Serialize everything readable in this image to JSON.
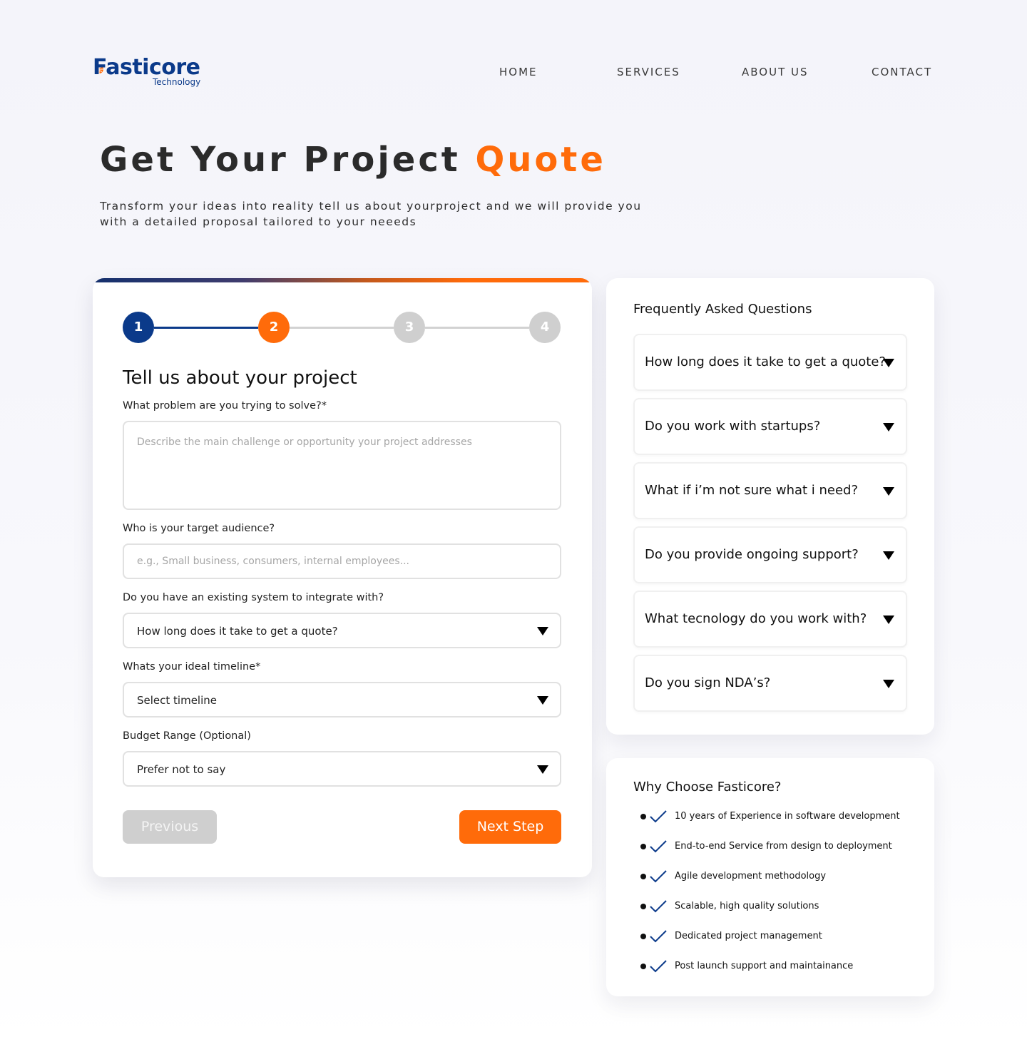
{
  "brand": {
    "name": "Fasticore",
    "sub": "Technology",
    "color": "#0b3a8a"
  },
  "nav": {
    "items": [
      {
        "label": "HOME"
      },
      {
        "label": "SERVICES"
      },
      {
        "label": "ABOUT US"
      },
      {
        "label": "CONTACT"
      }
    ]
  },
  "hero": {
    "title_main": "Get Your Project ",
    "title_accent": "Quote",
    "subtitle_line1": "Transform your ideas into reality tell us about yourproject and we will provide you",
    "subtitle_line2": "with a detailed proposal tailored to your neeeds"
  },
  "colors": {
    "accent": "#ff6b0a",
    "primary": "#0b3a8a",
    "inactive": "#cfcfcf"
  },
  "stepper": {
    "steps": [
      {
        "number": "1",
        "state": "completed"
      },
      {
        "number": "2",
        "state": "current"
      },
      {
        "number": "3",
        "state": "pending"
      },
      {
        "number": "4",
        "state": "pending"
      }
    ]
  },
  "form": {
    "title": "Tell us about your project",
    "problem": {
      "label": "What problem are you trying to solve?*",
      "placeholder": "Describe the main challenge or opportunity your project addresses"
    },
    "audience": {
      "label": "Who is your target audience?",
      "placeholder": "e.g., Small business, consumers, internal employees..."
    },
    "existing": {
      "label": "Do you have an existing system to integrate with?",
      "value": "How long does it take to get a quote?"
    },
    "timeline": {
      "label": "Whats your ideal timeline*",
      "value": "Select timeline"
    },
    "budget": {
      "label": "Budget Range (Optional)",
      "value": "Prefer not to say"
    },
    "prev_label": "Previous",
    "next_label": "Next Step"
  },
  "faq": {
    "title": "Frequently Asked Questions",
    "items": [
      {
        "q": "How long does it take to get a quote?"
      },
      {
        "q": "Do you work with startups?"
      },
      {
        "q": "What if i’m not sure what i need?"
      },
      {
        "q": "Do you provide ongoing support?"
      },
      {
        "q": "What tecnology do you work with?"
      },
      {
        "q": "Do you sign NDA’s?"
      }
    ]
  },
  "why": {
    "title": "Why Choose Fasticore?",
    "items": [
      {
        "text": "10 years of Experience in software development"
      },
      {
        "text": "End-to-end Service from design to deployment"
      },
      {
        "text": "Agile development methodology"
      },
      {
        "text": "Scalable, high quality solutions"
      },
      {
        "text": "Dedicated project management"
      },
      {
        "text": "Post launch support and maintainance"
      }
    ]
  }
}
